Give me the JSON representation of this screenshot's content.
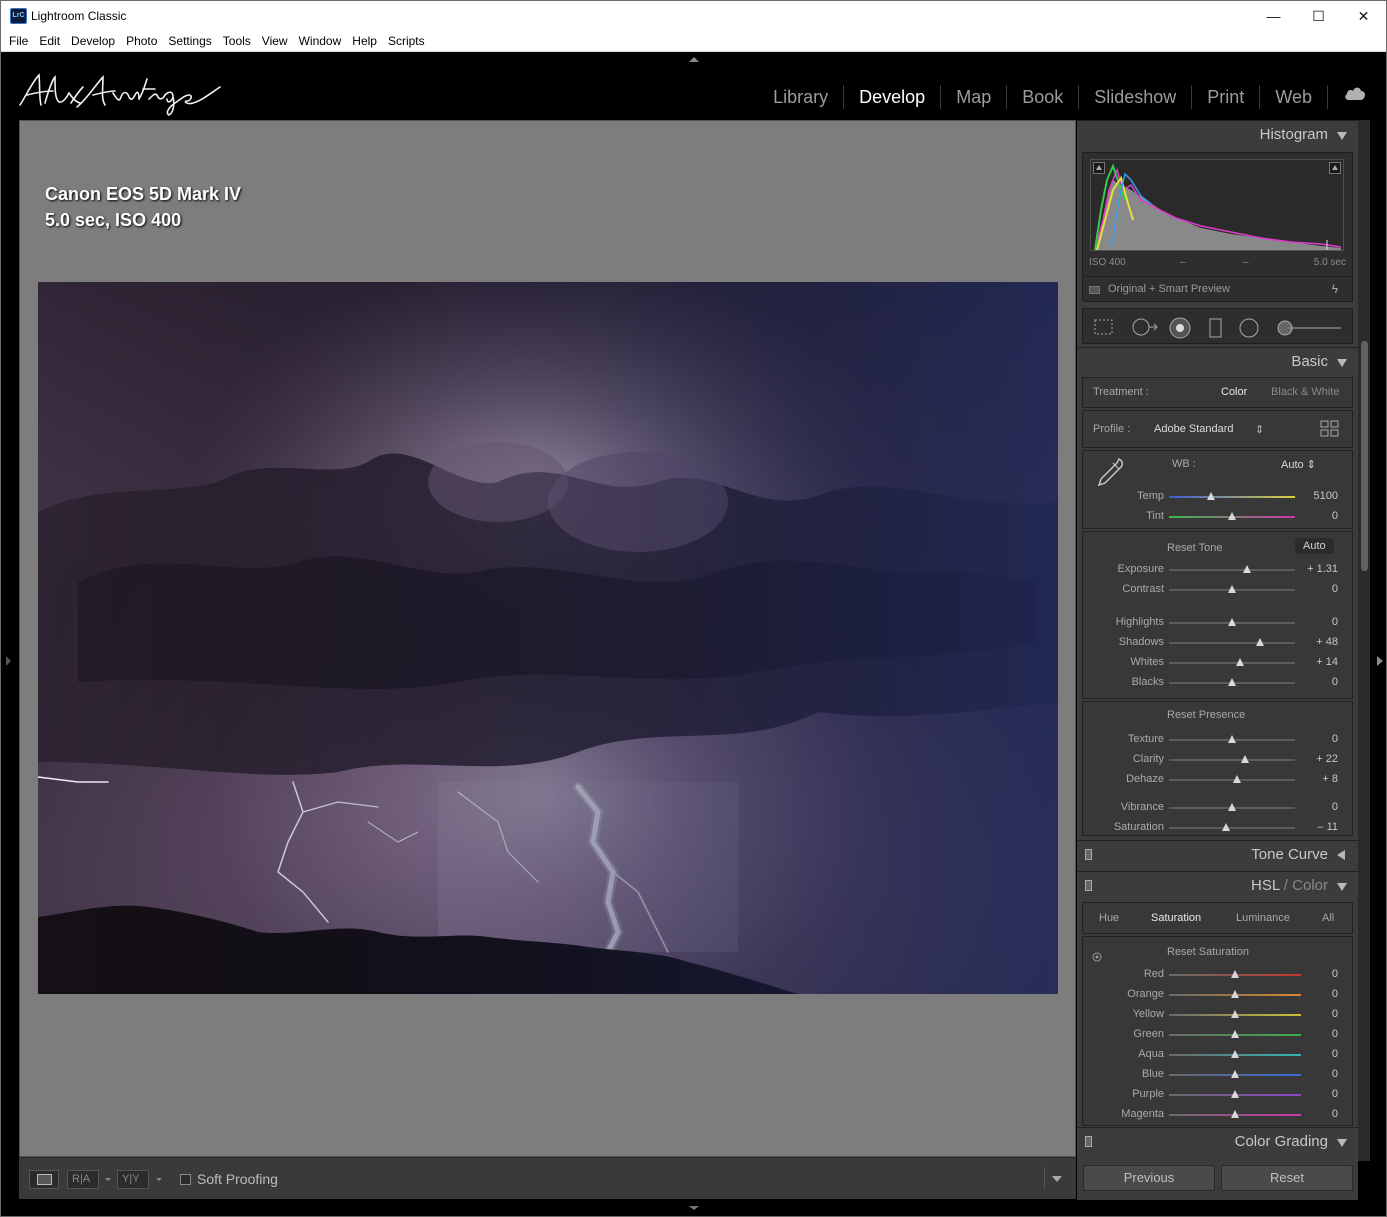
{
  "window": {
    "title": "Lightroom Classic",
    "icon_text": "LrC",
    "controls": {
      "minimize": "—",
      "maximize": "☐",
      "close": "✕"
    }
  },
  "menu": [
    "File",
    "Edit",
    "Develop",
    "Photo",
    "Settings",
    "Tools",
    "View",
    "Window",
    "Help",
    "Scripts"
  ],
  "modules": [
    "Library",
    "Develop",
    "Map",
    "Book",
    "Slideshow",
    "Print",
    "Web"
  ],
  "active_module": "Develop",
  "identity_plate": "Alex Armitage",
  "photo_info": {
    "line1": "Canon EOS 5D Mark IV",
    "line2": "5.0 sec, ISO 400"
  },
  "toolbar": {
    "view_ra": "R|A",
    "view_yy": "Y|Y",
    "soft_proofing": "Soft Proofing",
    "soft_proofing_checked": false
  },
  "histogram": {
    "title": "Histogram",
    "iso": "ISO 400",
    "dash1": "–",
    "dash2": "–",
    "shutter": "5.0 sec",
    "preview": "Original + Smart Preview"
  },
  "basic": {
    "title": "Basic",
    "treatment_label": "Treatment :",
    "treatment_color": "Color",
    "treatment_bw": "Black & White",
    "profile_label": "Profile :",
    "profile_value": "Adobe Standard",
    "profile_arrows": "⇕",
    "wb_label": "WB :",
    "wb_value": "Auto ⇕",
    "temp_label": "Temp",
    "temp_value": "5100",
    "temp_pos": 0.33,
    "tint_label": "Tint",
    "tint_value": "0",
    "tint_pos": 0.5,
    "reset_tone": "Reset Tone",
    "auto": "Auto",
    "tone": [
      {
        "label": "Exposure",
        "value": "+ 1.31",
        "pos": 0.62
      },
      {
        "label": "Contrast",
        "value": "0",
        "pos": 0.5
      }
    ],
    "tone2": [
      {
        "label": "Highlights",
        "value": "0",
        "pos": 0.5
      },
      {
        "label": "Shadows",
        "value": "+ 48",
        "pos": 0.72
      },
      {
        "label": "Whites",
        "value": "+ 14",
        "pos": 0.56
      },
      {
        "label": "Blacks",
        "value": "0",
        "pos": 0.5
      }
    ],
    "reset_presence": "Reset Presence",
    "presence": [
      {
        "label": "Texture",
        "value": "0",
        "pos": 0.5
      },
      {
        "label": "Clarity",
        "value": "+ 22",
        "pos": 0.6
      },
      {
        "label": "Dehaze",
        "value": "+ 8",
        "pos": 0.54
      }
    ],
    "presence2": [
      {
        "label": "Vibrance",
        "value": "0",
        "pos": 0.5
      },
      {
        "label": "Saturation",
        "value": "– 11",
        "pos": 0.45
      }
    ]
  },
  "tone_curve": {
    "title": "Tone Curve"
  },
  "hsl": {
    "title_a": "HSL",
    "title_sep": " / ",
    "title_b": "Color",
    "tabs": [
      "Hue",
      "Saturation",
      "Luminance",
      "All"
    ],
    "active_tab": "Saturation",
    "reset": "Reset Saturation",
    "sliders": [
      {
        "label": "Red",
        "value": "0",
        "pos": 0.5,
        "color": "#c0392b"
      },
      {
        "label": "Orange",
        "value": "0",
        "pos": 0.5,
        "color": "#d58a2a"
      },
      {
        "label": "Yellow",
        "value": "0",
        "pos": 0.5,
        "color": "#c8c23a"
      },
      {
        "label": "Green",
        "value": "0",
        "pos": 0.5,
        "color": "#3fae49"
      },
      {
        "label": "Aqua",
        "value": "0",
        "pos": 0.5,
        "color": "#36b3b3"
      },
      {
        "label": "Blue",
        "value": "0",
        "pos": 0.5,
        "color": "#3a6bd8"
      },
      {
        "label": "Purple",
        "value": "0",
        "pos": 0.5,
        "color": "#8a46c8"
      },
      {
        "label": "Magenta",
        "value": "0",
        "pos": 0.5,
        "color": "#c83aa8"
      }
    ]
  },
  "color_grading": {
    "title": "Color Grading"
  },
  "buttons": {
    "previous": "Previous",
    "reset": "Reset"
  }
}
